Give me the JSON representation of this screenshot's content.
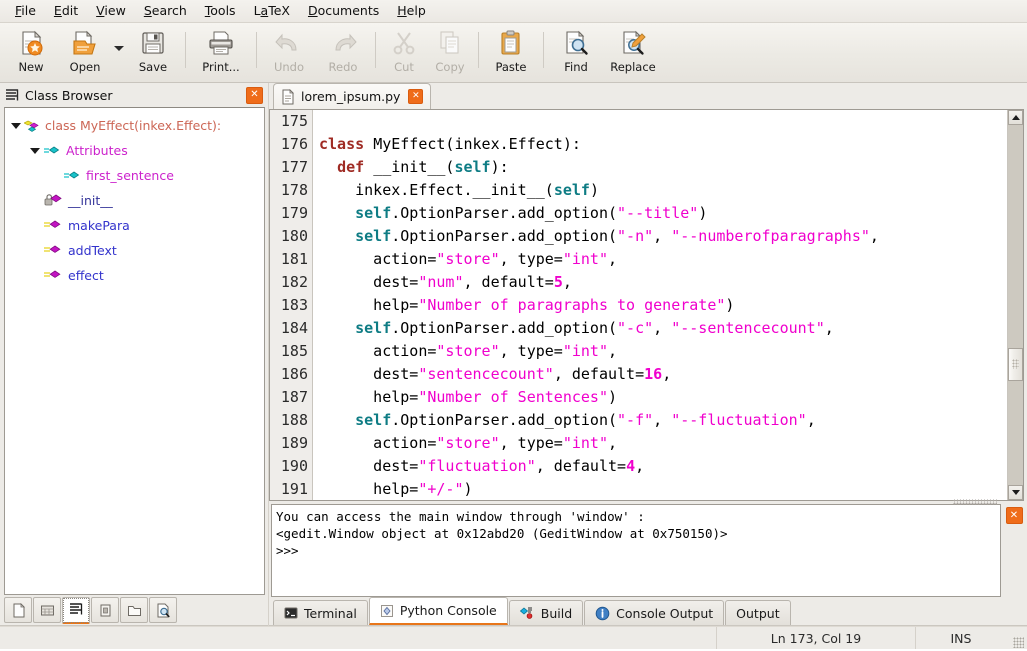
{
  "menubar": {
    "items": [
      {
        "label": "File",
        "mnemonic": "F"
      },
      {
        "label": "Edit",
        "mnemonic": "E"
      },
      {
        "label": "View",
        "mnemonic": "V"
      },
      {
        "label": "Search",
        "mnemonic": "S"
      },
      {
        "label": "Tools",
        "mnemonic": "T"
      },
      {
        "label": "LaTeX",
        "mnemonic": "a"
      },
      {
        "label": "Documents",
        "mnemonic": "D"
      },
      {
        "label": "Help",
        "mnemonic": "H"
      }
    ]
  },
  "toolbar": {
    "buttons": [
      {
        "label": "New",
        "icon": "new-document-icon",
        "disabled": false
      },
      {
        "label": "Open",
        "icon": "open-folder-icon",
        "disabled": false
      },
      {
        "label": "Save",
        "icon": "floppy-disk-icon",
        "disabled": false
      },
      {
        "label": "Print...",
        "icon": "printer-icon",
        "disabled": false
      },
      {
        "label": "Undo",
        "icon": "undo-arrow-icon",
        "disabled": true
      },
      {
        "label": "Redo",
        "icon": "redo-arrow-icon",
        "disabled": true
      },
      {
        "label": "Cut",
        "icon": "scissors-icon",
        "disabled": true
      },
      {
        "label": "Copy",
        "icon": "copy-pages-icon",
        "disabled": true
      },
      {
        "label": "Paste",
        "icon": "clipboard-icon",
        "disabled": false
      },
      {
        "label": "Find",
        "icon": "find-magnifier-icon",
        "disabled": false
      },
      {
        "label": "Replace",
        "icon": "replace-pencil-icon",
        "disabled": false
      }
    ]
  },
  "sidepanel": {
    "title": "Class Browser",
    "tree": [
      {
        "label": "class MyEffect(inkex.Effect):",
        "indent": 0,
        "color": "#cc6655",
        "expander": "expanded",
        "icon": "class-node-icon"
      },
      {
        "label": "Attributes",
        "indent": 1,
        "color": "#cc22cc",
        "expander": "expanded",
        "icon": "attributes-node-icon"
      },
      {
        "label": "first_sentence",
        "indent": 2,
        "color": "#cc22cc",
        "expander": "none",
        "icon": "attribute-node-icon"
      },
      {
        "label": "__init__",
        "indent": 1,
        "color": "#333399",
        "expander": "none",
        "icon": "private-method-node-icon"
      },
      {
        "label": "makePara",
        "indent": 1,
        "color": "#3333cc",
        "expander": "none",
        "icon": "method-node-icon"
      },
      {
        "label": "addText",
        "indent": 1,
        "color": "#3333cc",
        "expander": "none",
        "icon": "method-node-icon"
      },
      {
        "label": "effect",
        "indent": 1,
        "color": "#3333cc",
        "expander": "none",
        "icon": "method-node-icon"
      }
    ],
    "bottom_buttons": [
      {
        "icon": "blank-document-icon",
        "active": false
      },
      {
        "icon": "file-browser-icon",
        "active": false
      },
      {
        "icon": "class-browser-icon",
        "active": true
      },
      {
        "icon": "snippets-icon",
        "active": false
      },
      {
        "icon": "folder-icon",
        "active": false
      },
      {
        "icon": "document-search-icon",
        "active": false
      }
    ]
  },
  "editor": {
    "tab": {
      "title": "lorem_ipsum.py",
      "icon": "python-file-icon",
      "close_icon": "close-icon"
    },
    "first_line_number": 175,
    "lines": [
      {
        "num": 175,
        "tokens": [
          {
            "t": "",
            "c": "plain"
          }
        ]
      },
      {
        "num": 176,
        "tokens": [
          {
            "t": "class ",
            "c": "kw"
          },
          {
            "t": "MyEffect(inkex.Effect):",
            "c": "plain"
          }
        ]
      },
      {
        "num": 177,
        "tokens": [
          {
            "t": "  ",
            "c": "plain"
          },
          {
            "t": "def ",
            "c": "kw"
          },
          {
            "t": "__init__(",
            "c": "plain"
          },
          {
            "t": "self",
            "c": "self"
          },
          {
            "t": "):",
            "c": "plain"
          }
        ]
      },
      {
        "num": 178,
        "tokens": [
          {
            "t": "    inkex.Effect.__init__(",
            "c": "plain"
          },
          {
            "t": "self",
            "c": "self"
          },
          {
            "t": ")",
            "c": "plain"
          }
        ]
      },
      {
        "num": 179,
        "tokens": [
          {
            "t": "    ",
            "c": "plain"
          },
          {
            "t": "self",
            "c": "self"
          },
          {
            "t": ".OptionParser.add_option(",
            "c": "plain"
          },
          {
            "t": "\"--title\"",
            "c": "str"
          },
          {
            "t": ")",
            "c": "plain"
          }
        ]
      },
      {
        "num": 180,
        "tokens": [
          {
            "t": "    ",
            "c": "plain"
          },
          {
            "t": "self",
            "c": "self"
          },
          {
            "t": ".OptionParser.add_option(",
            "c": "plain"
          },
          {
            "t": "\"-n\"",
            "c": "str"
          },
          {
            "t": ", ",
            "c": "plain"
          },
          {
            "t": "\"--numberofparagraphs\"",
            "c": "str"
          },
          {
            "t": ",",
            "c": "plain"
          }
        ]
      },
      {
        "num": 181,
        "tokens": [
          {
            "t": "      action=",
            "c": "plain"
          },
          {
            "t": "\"store\"",
            "c": "str"
          },
          {
            "t": ", type=",
            "c": "plain"
          },
          {
            "t": "\"int\"",
            "c": "str"
          },
          {
            "t": ",",
            "c": "plain"
          }
        ]
      },
      {
        "num": 182,
        "tokens": [
          {
            "t": "      dest=",
            "c": "plain"
          },
          {
            "t": "\"num\"",
            "c": "str"
          },
          {
            "t": ", default=",
            "c": "plain"
          },
          {
            "t": "5",
            "c": "num"
          },
          {
            "t": ",",
            "c": "plain"
          }
        ]
      },
      {
        "num": 183,
        "tokens": [
          {
            "t": "      help=",
            "c": "plain"
          },
          {
            "t": "\"Number of paragraphs to generate\"",
            "c": "str"
          },
          {
            "t": ")",
            "c": "plain"
          }
        ]
      },
      {
        "num": 184,
        "tokens": [
          {
            "t": "    ",
            "c": "plain"
          },
          {
            "t": "self",
            "c": "self"
          },
          {
            "t": ".OptionParser.add_option(",
            "c": "plain"
          },
          {
            "t": "\"-c\"",
            "c": "str"
          },
          {
            "t": ", ",
            "c": "plain"
          },
          {
            "t": "\"--sentencecount\"",
            "c": "str"
          },
          {
            "t": ",",
            "c": "plain"
          }
        ]
      },
      {
        "num": 185,
        "tokens": [
          {
            "t": "      action=",
            "c": "plain"
          },
          {
            "t": "\"store\"",
            "c": "str"
          },
          {
            "t": ", type=",
            "c": "plain"
          },
          {
            "t": "\"int\"",
            "c": "str"
          },
          {
            "t": ",",
            "c": "plain"
          }
        ]
      },
      {
        "num": 186,
        "tokens": [
          {
            "t": "      dest=",
            "c": "plain"
          },
          {
            "t": "\"sentencecount\"",
            "c": "str"
          },
          {
            "t": ", default=",
            "c": "plain"
          },
          {
            "t": "16",
            "c": "num"
          },
          {
            "t": ",",
            "c": "plain"
          }
        ]
      },
      {
        "num": 187,
        "tokens": [
          {
            "t": "      help=",
            "c": "plain"
          },
          {
            "t": "\"Number of Sentences\"",
            "c": "str"
          },
          {
            "t": ")",
            "c": "plain"
          }
        ]
      },
      {
        "num": 188,
        "tokens": [
          {
            "t": "    ",
            "c": "plain"
          },
          {
            "t": "self",
            "c": "self"
          },
          {
            "t": ".OptionParser.add_option(",
            "c": "plain"
          },
          {
            "t": "\"-f\"",
            "c": "str"
          },
          {
            "t": ", ",
            "c": "plain"
          },
          {
            "t": "\"--fluctuation\"",
            "c": "str"
          },
          {
            "t": ",",
            "c": "plain"
          }
        ]
      },
      {
        "num": 189,
        "tokens": [
          {
            "t": "      action=",
            "c": "plain"
          },
          {
            "t": "\"store\"",
            "c": "str"
          },
          {
            "t": ", type=",
            "c": "plain"
          },
          {
            "t": "\"int\"",
            "c": "str"
          },
          {
            "t": ",",
            "c": "plain"
          }
        ]
      },
      {
        "num": 190,
        "tokens": [
          {
            "t": "      dest=",
            "c": "plain"
          },
          {
            "t": "\"fluctuation\"",
            "c": "str"
          },
          {
            "t": ", default=",
            "c": "plain"
          },
          {
            "t": "4",
            "c": "num"
          },
          {
            "t": ",",
            "c": "plain"
          }
        ]
      },
      {
        "num": 191,
        "tokens": [
          {
            "t": "      help=",
            "c": "plain"
          },
          {
            "t": "\"+/-\"",
            "c": "str"
          },
          {
            "t": ")",
            "c": "plain"
          }
        ]
      }
    ]
  },
  "console": {
    "text": "You can access the main window through 'window' :\n<gedit.Window object at 0x12abd20 (GeditWindow at 0x750150)>\n>>>",
    "close_icon": "close-icon",
    "tabs": [
      {
        "label": "Terminal",
        "icon": "terminal-icon",
        "active": false
      },
      {
        "label": "Python Console",
        "icon": "python-console-icon",
        "active": true
      },
      {
        "label": "Build",
        "icon": "build-icon",
        "active": false
      },
      {
        "label": "Console Output",
        "icon": "info-icon",
        "active": false
      },
      {
        "label": "Output",
        "icon": "none",
        "active": false
      }
    ]
  },
  "statusbar": {
    "position": "Ln 173, Col 19",
    "insert_mode": "INS"
  },
  "colors": {
    "accent": "#e8761a",
    "close_button": "#ef6c1a",
    "keyword": "#9f2b24",
    "string": "#f000cd",
    "builtin": "#0e7c84",
    "window_bg": "#edebe7"
  }
}
